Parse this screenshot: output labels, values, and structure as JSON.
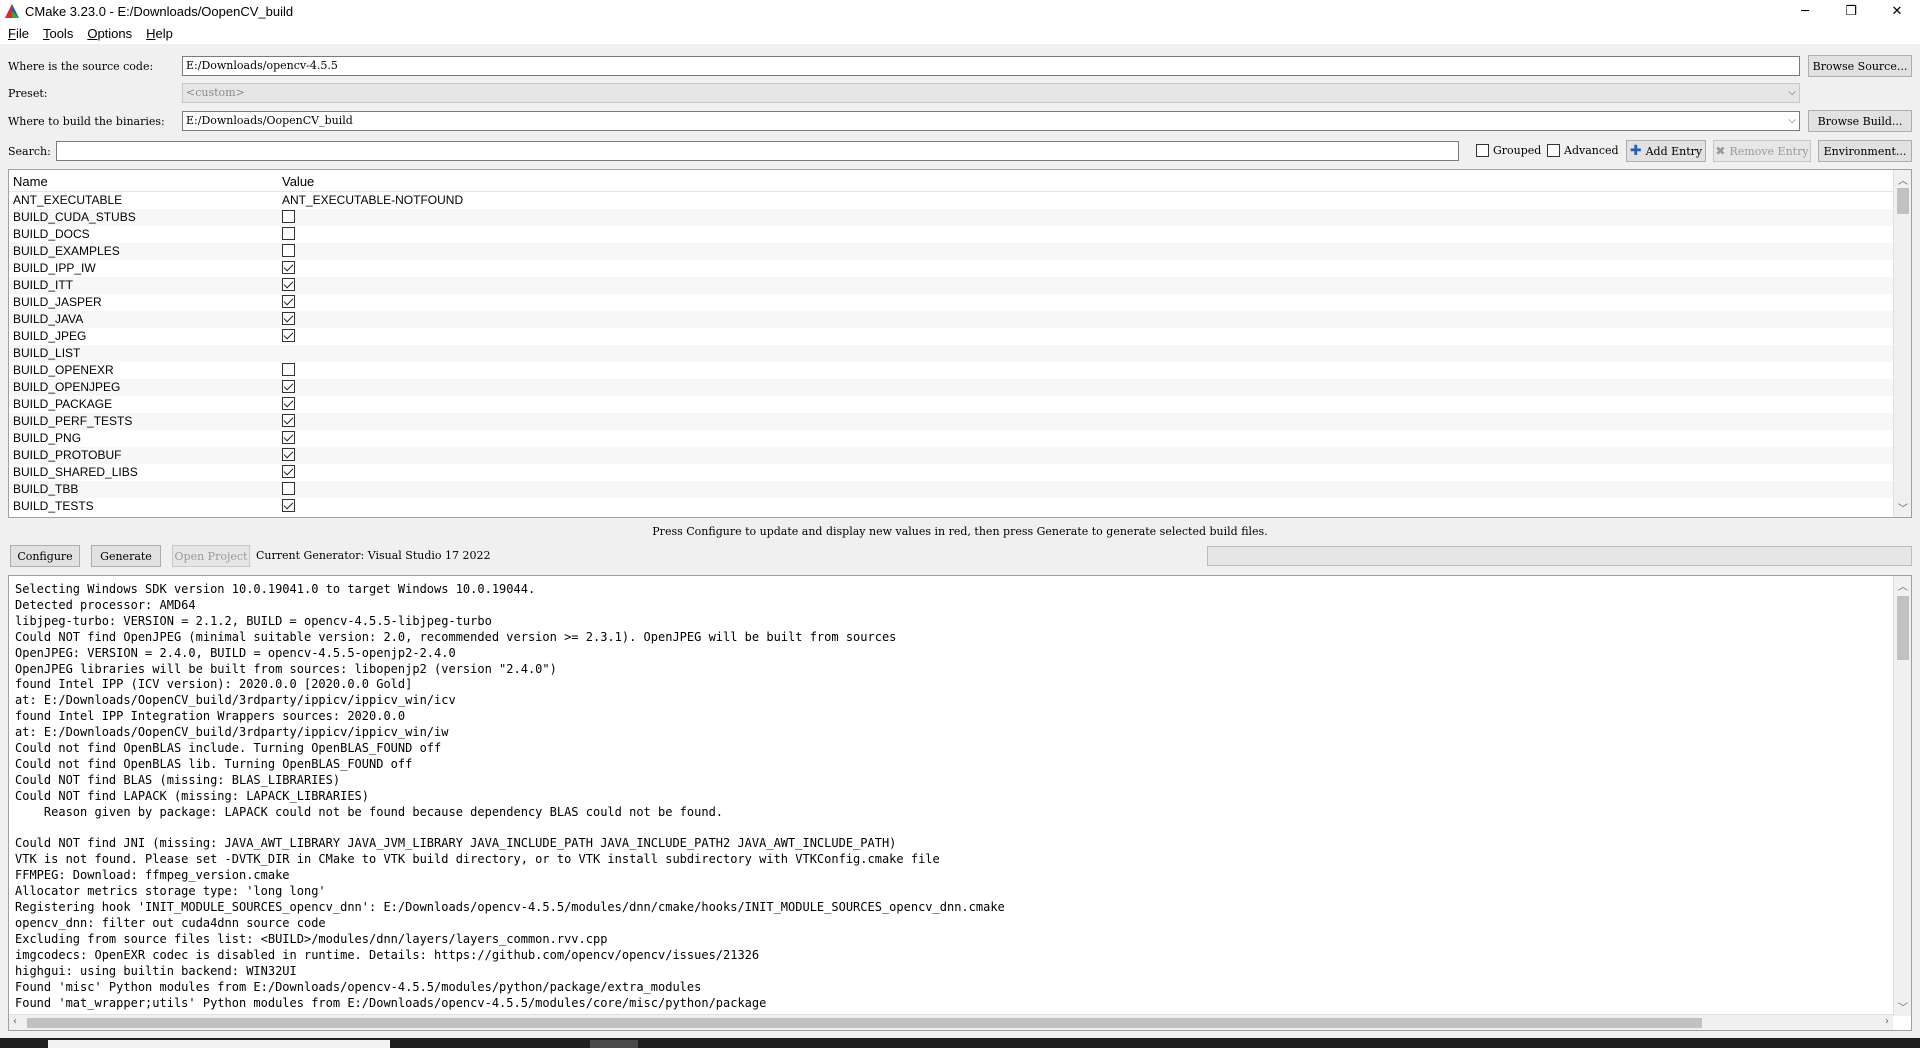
{
  "window": {
    "title": "CMake 3.23.0 - E:/Downloads/OopenCV_build",
    "minimize": "─",
    "restore": "❐",
    "close": "✕"
  },
  "menu": {
    "items": [
      "File",
      "Tools",
      "Options",
      "Help"
    ],
    "accel": [
      "F",
      "T",
      "O",
      "H"
    ]
  },
  "source": {
    "label": "Where is the source code:",
    "value": "E:/Downloads/opencv-4.5.5",
    "browse": "Browse Source..."
  },
  "preset": {
    "label": "Preset:",
    "value": "<custom>"
  },
  "build": {
    "label": "Where to build the binaries:",
    "value": "E:/Downloads/OopenCV_build",
    "browse": "Browse Build..."
  },
  "search": {
    "label": "Search:",
    "value": ""
  },
  "options": {
    "grouped": "Grouped",
    "advanced": "Advanced",
    "add_entry": "Add Entry",
    "remove_entry": "Remove Entry",
    "environment": "Environment..."
  },
  "table": {
    "col_name": "Name",
    "col_value": "Value",
    "rows": [
      {
        "name": "ANT_EXECUTABLE",
        "type": "text",
        "value": "ANT_EXECUTABLE-NOTFOUND"
      },
      {
        "name": "BUILD_CUDA_STUBS",
        "type": "bool",
        "checked": false
      },
      {
        "name": "BUILD_DOCS",
        "type": "bool",
        "checked": false
      },
      {
        "name": "BUILD_EXAMPLES",
        "type": "bool",
        "checked": false
      },
      {
        "name": "BUILD_IPP_IW",
        "type": "bool",
        "checked": true
      },
      {
        "name": "BUILD_ITT",
        "type": "bool",
        "checked": true
      },
      {
        "name": "BUILD_JASPER",
        "type": "bool",
        "checked": true
      },
      {
        "name": "BUILD_JAVA",
        "type": "bool",
        "checked": true
      },
      {
        "name": "BUILD_JPEG",
        "type": "bool",
        "checked": true
      },
      {
        "name": "BUILD_LIST",
        "type": "text",
        "value": ""
      },
      {
        "name": "BUILD_OPENEXR",
        "type": "bool",
        "checked": false
      },
      {
        "name": "BUILD_OPENJPEG",
        "type": "bool",
        "checked": true
      },
      {
        "name": "BUILD_PACKAGE",
        "type": "bool",
        "checked": true
      },
      {
        "name": "BUILD_PERF_TESTS",
        "type": "bool",
        "checked": true
      },
      {
        "name": "BUILD_PNG",
        "type": "bool",
        "checked": true
      },
      {
        "name": "BUILD_PROTOBUF",
        "type": "bool",
        "checked": true
      },
      {
        "name": "BUILD_SHARED_LIBS",
        "type": "bool",
        "checked": true
      },
      {
        "name": "BUILD_TBB",
        "type": "bool",
        "checked": false
      },
      {
        "name": "BUILD_TESTS",
        "type": "bool",
        "checked": true
      }
    ]
  },
  "hint": "Press Configure to update and display new values in red, then press Generate to generate selected build files.",
  "actions": {
    "configure": "Configure",
    "generate": "Generate",
    "open_project": "Open Project",
    "generator": "Current Generator: Visual Studio 17 2022"
  },
  "log": [
    "Selecting Windows SDK version 10.0.19041.0 to target Windows 10.0.19044.",
    "Detected processor: AMD64",
    "libjpeg-turbo: VERSION = 2.1.2, BUILD = opencv-4.5.5-libjpeg-turbo",
    "Could NOT find OpenJPEG (minimal suitable version: 2.0, recommended version >= 2.3.1). OpenJPEG will be built from sources",
    "OpenJPEG: VERSION = 2.4.0, BUILD = opencv-4.5.5-openjp2-2.4.0",
    "OpenJPEG libraries will be built from sources: libopenjp2 (version \"2.4.0\")",
    "found Intel IPP (ICV version): 2020.0.0 [2020.0.0 Gold]",
    "at: E:/Downloads/OopenCV_build/3rdparty/ippicv/ippicv_win/icv",
    "found Intel IPP Integration Wrappers sources: 2020.0.0",
    "at: E:/Downloads/OopenCV_build/3rdparty/ippicv/ippicv_win/iw",
    "Could not find OpenBLAS include. Turning OpenBLAS_FOUND off",
    "Could not find OpenBLAS lib. Turning OpenBLAS_FOUND off",
    "Could NOT find BLAS (missing: BLAS_LIBRARIES)",
    "Could NOT find LAPACK (missing: LAPACK_LIBRARIES)",
    "    Reason given by package: LAPACK could not be found because dependency BLAS could not be found.",
    "",
    "Could NOT find JNI (missing: JAVA_AWT_LIBRARY JAVA_JVM_LIBRARY JAVA_INCLUDE_PATH JAVA_INCLUDE_PATH2 JAVA_AWT_INCLUDE_PATH)",
    "VTK is not found. Please set -DVTK_DIR in CMake to VTK build directory, or to VTK install subdirectory with VTKConfig.cmake file",
    "FFMPEG: Download: ffmpeg_version.cmake",
    "Allocator metrics storage type: 'long long'",
    "Registering hook 'INIT_MODULE_SOURCES_opencv_dnn': E:/Downloads/opencv-4.5.5/modules/dnn/cmake/hooks/INIT_MODULE_SOURCES_opencv_dnn.cmake",
    "opencv_dnn: filter out cuda4dnn source code",
    "Excluding from source files list: <BUILD>/modules/dnn/layers/layers_common.rvv.cpp",
    "imgcodecs: OpenEXR codec is disabled in runtime. Details: https://github.com/opencv/opencv/issues/21326",
    "highgui: using builtin backend: WIN32UI",
    "Found 'misc' Python modules from E:/Downloads/opencv-4.5.5/modules/python/package/extra_modules",
    "Found 'mat_wrapper;utils' Python modules from E:/Downloads/opencv-4.5.5/modules/core/misc/python/package"
  ]
}
